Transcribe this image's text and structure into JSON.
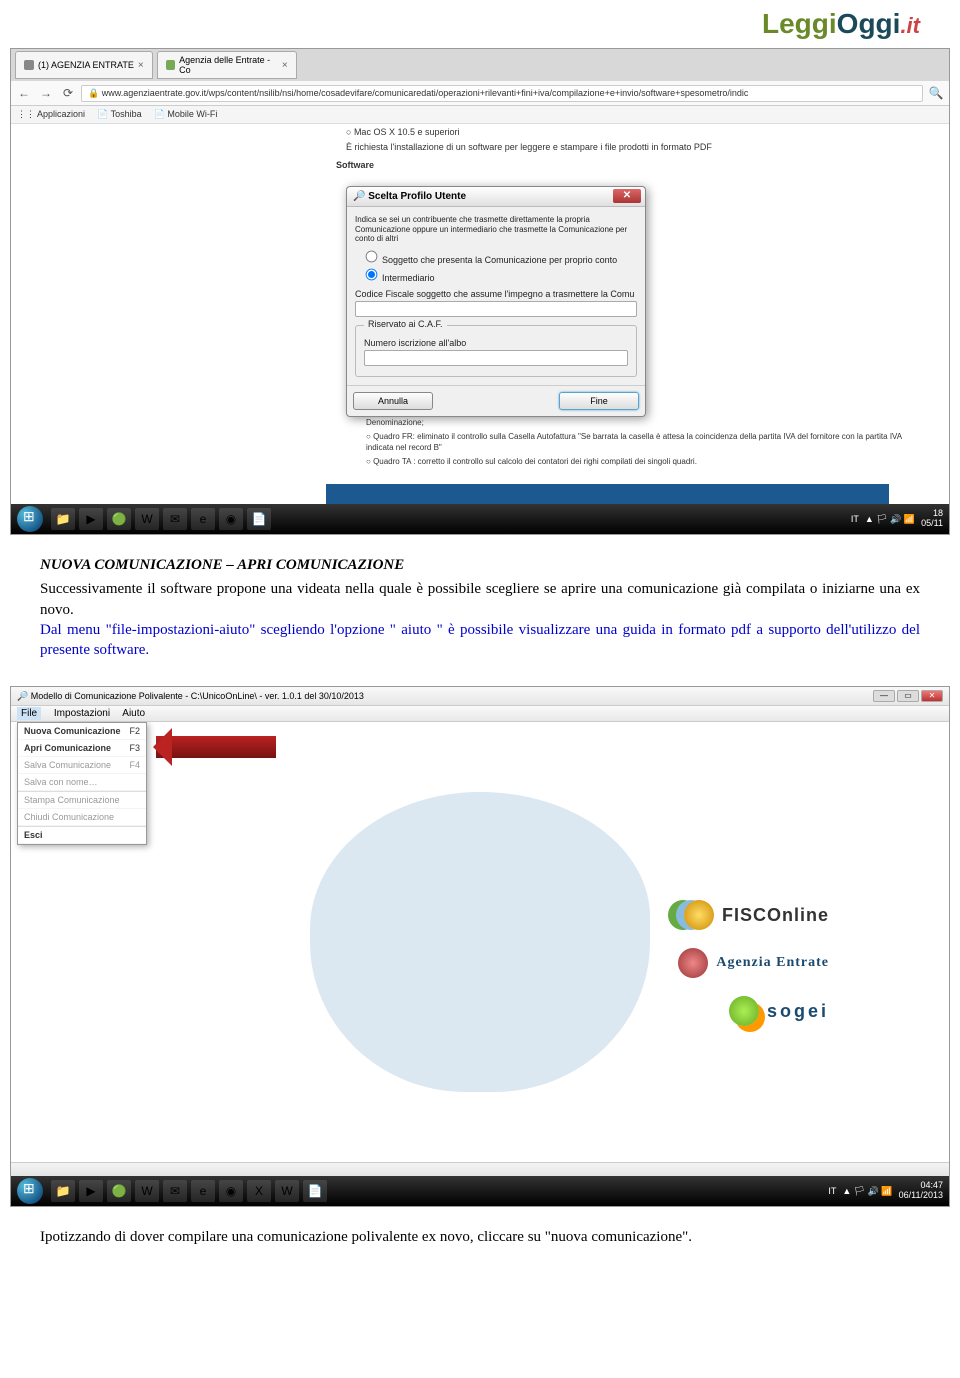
{
  "toplogo": {
    "part1": "Leggi",
    "part2": "Oggi",
    "part3": ".it"
  },
  "browser1": {
    "tab1": "(1) AGENZIA ENTRATE",
    "tab2": "Agenzia delle Entrate - Co",
    "url": "www.agenziaentrate.gov.it/wps/content/nsilib/nsi/home/cosadevifare/comunicaredati/operazioni+rilevanti+fini+iva/compilazione+e+invio/software+spesometro/indic",
    "apps": "Applicazioni",
    "bk1": "Toshiba",
    "bk2": "Mobile Wi-Fi",
    "bg_line1": "Mac OS X 10.5 e superiori",
    "bg_line2": "È richiesta l'installazione di un software per leggere e stampare i file prodotti in formato PDF",
    "bg_hd": "Software"
  },
  "dialog": {
    "title": "Scelta Profilo Utente",
    "intro": "Indica se sei un contribuente che trasmette direttamente la propria Comunicazione oppure un intermediario che trasmette la Comunicazione per conto di altri",
    "opt1": "Soggetto che presenta la Comunicazione per proprio conto",
    "opt2": "Intermediario",
    "cf_label": "Codice Fiscale soggetto che assume l'impegno a trasmettere la Comu",
    "caf_legend": "Riservato ai C.A.F.",
    "caf_label": "Numero iscrizione all'albo",
    "cancel": "Annulla",
    "ok": "Fine"
  },
  "finetext": {
    "l1": "Denominazione;",
    "l2": "Quadro FR: eliminato il controllo sulla Casella Autofattura \"Se barrata la casella è attesa la coincidenza della partita IVA del fornitore con la partita IVA indicata nel record B\"",
    "l3": "Quadro TA : corretto il controllo sul calcolo dei contatori dei righi compilati dei singoli quadri."
  },
  "taskbar1": {
    "lang": "IT",
    "time": "18",
    "date": "05/11"
  },
  "taskbar2": {
    "lang": "IT",
    "time": "04:47",
    "date": "06/11/2013"
  },
  "doc1": {
    "heading": "NUOVA COMUNICAZIONE – APRI COMUNICAZIONE",
    "p1": "Successivamente il software propone una videata nella quale è possibile scegliere se aprire una comunicazione già compilata o iniziarne una ex novo.",
    "p2": "Dal menu \"file-impostazioni-aiuto\" scegliendo l'opzione \" aiuto \" è possibile visualizzare una guida in formato pdf a supporto dell'utilizzo del presente software."
  },
  "app": {
    "title": "Modello di Comunicazione Polivalente - C:\\UnicoOnLine\\ - ver. 1.0.1 del 30/10/2013",
    "menu": {
      "file": "File",
      "imp": "Impostazioni",
      "aiuto": "Aiuto"
    },
    "dropdown": {
      "nuova": "Nuova Comunicazione",
      "nuova_k": "F2",
      "apri": "Apri Comunicazione",
      "apri_k": "F3",
      "salva": "Salva Comunicazione",
      "salva_k": "F4",
      "salva_nome": "Salva con nome…",
      "stampa": "Stampa Comunicazione",
      "chiudi": "Chiudi Comunicazione",
      "esci": "Esci"
    },
    "logos": {
      "fisco": "FISCOnline",
      "agenzia": "Agenzia Entrate",
      "sogei": "sogei"
    }
  },
  "doc2": {
    "p": "Ipotizzando di dover compilare una comunicazione polivalente ex novo, cliccare su \"nuova comunicazione\"."
  }
}
